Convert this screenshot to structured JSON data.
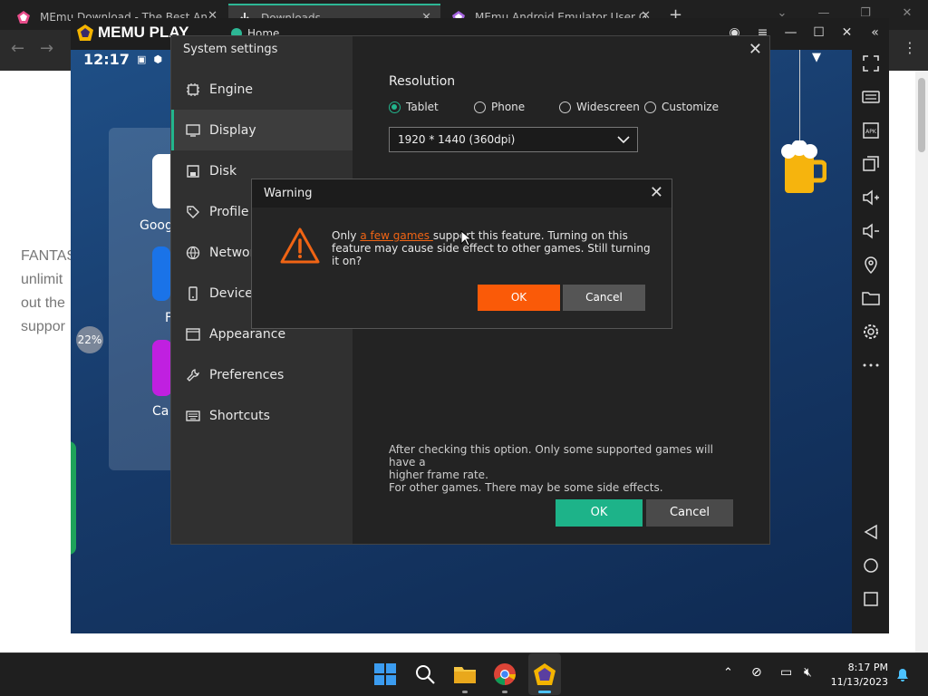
{
  "browser": {
    "tabs": [
      {
        "title": "MEmu Download - The Best An",
        "active": false
      },
      {
        "title": "Downloads",
        "active": true
      },
      {
        "title": "MEmu Android Emulator User G",
        "active": false
      }
    ],
    "new_tab": "+"
  },
  "webpage": {
    "text_lines": [
      "FANTAS",
      "unlimit",
      "out the",
      "suppor"
    ]
  },
  "emulator": {
    "logo": "MEMU PLAY",
    "home_tab": "Home",
    "status": {
      "time": "12:17"
    },
    "battery_badge": "22%",
    "apps": [
      "Goog",
      "F",
      "Ca"
    ]
  },
  "system_settings": {
    "title": "System settings",
    "nav": [
      {
        "label": "Engine",
        "icon": "chip-icon"
      },
      {
        "label": "Display",
        "icon": "monitor-icon",
        "selected": true
      },
      {
        "label": "Disk",
        "icon": "disk-icon"
      },
      {
        "label": "Profile",
        "icon": "tag-icon"
      },
      {
        "label": "Network",
        "icon": "globe-icon"
      },
      {
        "label": "Device",
        "icon": "phone-icon"
      },
      {
        "label": "Appearance",
        "icon": "window-icon"
      },
      {
        "label": "Preferences",
        "icon": "wrench-icon"
      },
      {
        "label": "Shortcuts",
        "icon": "keyboard-icon"
      }
    ],
    "resolution_label": "Resolution",
    "resolution_options": [
      "Tablet",
      "Phone",
      "Widescreen",
      "Customize"
    ],
    "resolution_selected": "Tablet",
    "resolution_value": "1920 * 1440 (360dpi)",
    "info_lines": [
      "After checking this option. Only some supported games will have a",
      "higher frame rate.",
      "For other games. There may be some side effects."
    ],
    "ok": "OK",
    "cancel": "Cancel"
  },
  "warning": {
    "title": "Warning",
    "msg_pre": "Only ",
    "msg_link": "a few games ",
    "msg_post": "support this feature. Turning on this feature may cause side effect to other games. Still turning it on?",
    "ok": "OK",
    "cancel": "Cancel"
  },
  "taskbar": {
    "time": "8:17 PM",
    "date": "11/13/2023"
  },
  "colors": {
    "accent_green": "#1db389",
    "warning_orange": "#fa5a08",
    "link_orange": "#f06414"
  }
}
